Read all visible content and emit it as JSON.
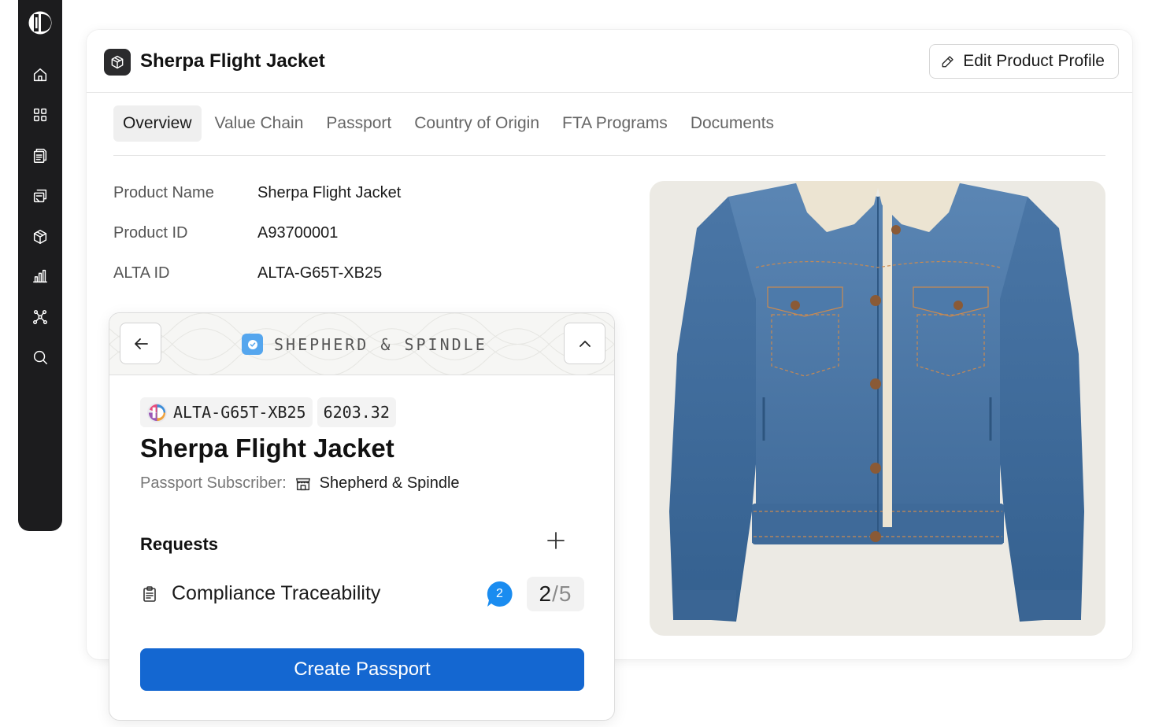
{
  "sidebar": {
    "items": [
      {
        "icon": "home-icon"
      },
      {
        "icon": "grid-icon"
      },
      {
        "icon": "documents-icon"
      },
      {
        "icon": "receipt-icon"
      },
      {
        "icon": "box-icon"
      },
      {
        "icon": "bar-chart-icon"
      },
      {
        "icon": "network-icon"
      },
      {
        "icon": "search-icon"
      }
    ]
  },
  "header": {
    "title": "Sherpa Flight Jacket",
    "edit_button": "Edit Product Profile"
  },
  "tabs": [
    {
      "label": "Overview",
      "active": true
    },
    {
      "label": "Value Chain",
      "active": false
    },
    {
      "label": "Passport",
      "active": false
    },
    {
      "label": "Country of Origin",
      "active": false
    },
    {
      "label": "FTA Programs",
      "active": false
    },
    {
      "label": "Documents",
      "active": false
    }
  ],
  "overview": {
    "fields": [
      {
        "label": "Product Name",
        "value": "Sherpa Flight Jacket"
      },
      {
        "label": "Product ID",
        "value": "A93700001"
      },
      {
        "label": "ALTA ID",
        "value": "ALTA-G65T-XB25"
      }
    ]
  },
  "passport": {
    "brand": "SHEPHERD & SPINDLE",
    "alta_id": "ALTA-G65T-XB25",
    "hs_code": "6203.32",
    "title": "Sherpa Flight Jacket",
    "subscriber_label": "Passport Subscriber:",
    "subscriber_name": "Shepherd & Spindle",
    "requests_title": "Requests",
    "requests": [
      {
        "label": "Compliance Traceability",
        "comments": "2",
        "done": "2",
        "sep": "/",
        "total": "5"
      }
    ],
    "create_button": "Create Passport"
  },
  "colors": {
    "sidebar": "#1c1c1e",
    "primary": "#1467d1",
    "badge_blue": "#1a8cf0",
    "brand_badge": "#55a6ee"
  }
}
